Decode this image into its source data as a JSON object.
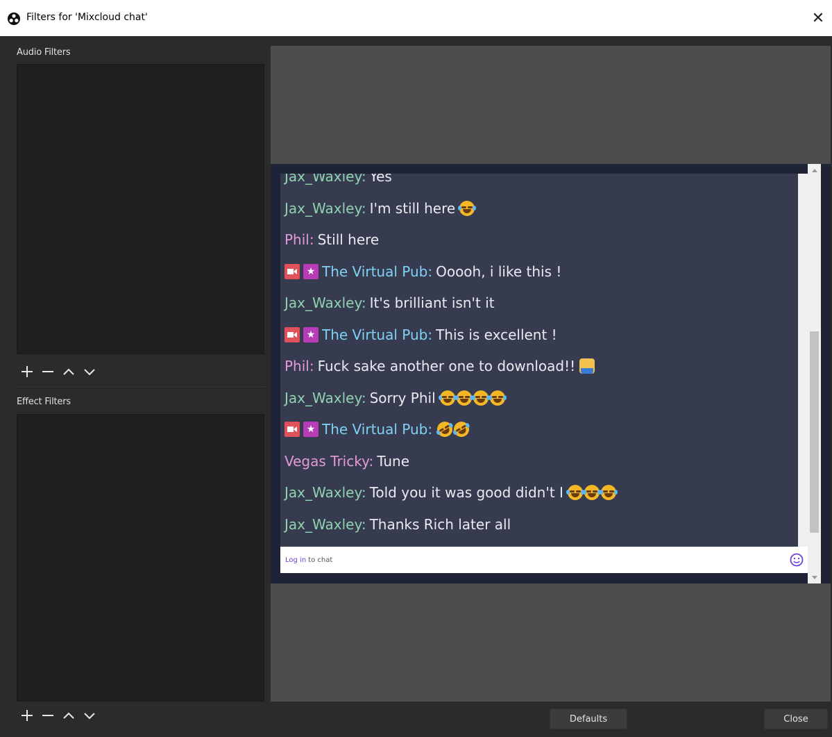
{
  "window": {
    "title": "Filters for 'Mixcloud chat'",
    "close_glyph": "✕"
  },
  "audio_filters": {
    "label": "Audio Filters"
  },
  "effect_filters": {
    "label": "Effect Filters"
  },
  "chat": {
    "messages": [
      {
        "user": "Jax_Waxley:",
        "text": "Yes",
        "color": "#8fd3b0"
      },
      {
        "user": "Jax_Waxley:",
        "text": "I'm still here",
        "color": "#8fd3b0",
        "emojis": [
          "joy"
        ]
      },
      {
        "user": "Phil:",
        "text": "Still here",
        "color": "#e39ad7"
      },
      {
        "user": "The Virtual Pub:",
        "text": "Ooooh, i like this !",
        "color": "#7fd2f4",
        "badges": [
          "camera",
          "star"
        ]
      },
      {
        "user": "Jax_Waxley:",
        "text": "It's brilliant isn't it",
        "color": "#8fd3b0"
      },
      {
        "user": "The Virtual Pub:",
        "text": "This is excellent !",
        "color": "#7fd2f4",
        "badges": [
          "camera",
          "star"
        ]
      },
      {
        "user": "Phil:",
        "text": "Fuck sake another one to download!!",
        "color": "#e39ad7",
        "emojis": [
          "facepalm"
        ]
      },
      {
        "user": "Jax_Waxley:",
        "text": "Sorry Phil",
        "color": "#8fd3b0",
        "emojis": [
          "joy",
          "joy",
          "joy",
          "joy"
        ]
      },
      {
        "user": "The Virtual Pub:",
        "text": "",
        "color": "#7fd2f4",
        "badges": [
          "camera",
          "star"
        ],
        "emojis": [
          "rofl",
          "rofl"
        ]
      },
      {
        "user": "Vegas Tricky:",
        "text": "Tune",
        "color": "#e39ad7"
      },
      {
        "user": "Jax_Waxley:",
        "text": "Told you it was good didn't I",
        "color": "#8fd3b0",
        "emojis": [
          "joy",
          "joy",
          "joy"
        ]
      },
      {
        "user": "Jax_Waxley:",
        "text": "Thanks Rich later all",
        "color": "#8fd3b0"
      }
    ],
    "login_link": "Log in",
    "login_rest": "to chat"
  },
  "buttons": {
    "defaults": "Defaults",
    "close": "Close"
  },
  "colors": {
    "chat_bg": "#363b4f",
    "frame_bg": "#1e2436",
    "panel_bg": "#2b2b2b",
    "preview_bg": "#4c4c4c"
  }
}
